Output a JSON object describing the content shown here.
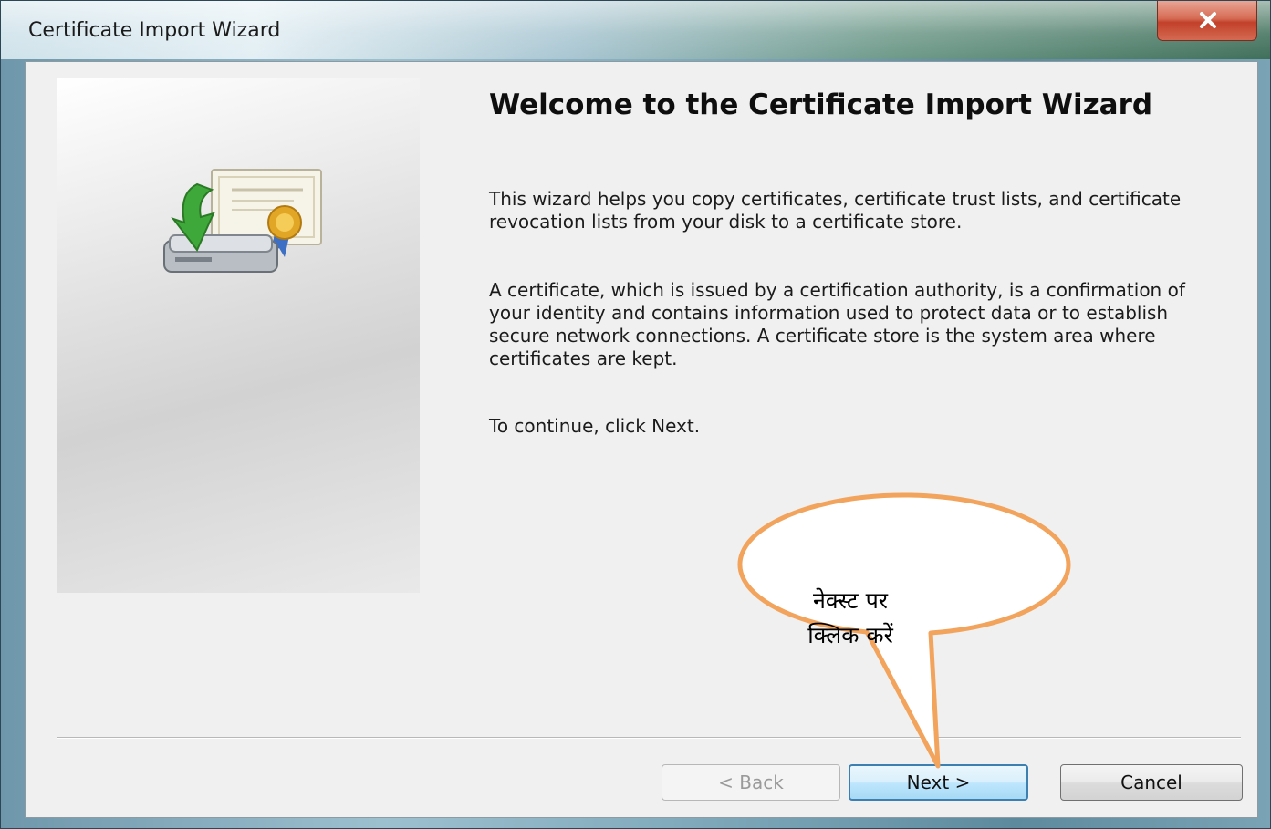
{
  "window": {
    "title": "Certificate Import Wizard",
    "close_icon": "close-icon"
  },
  "content": {
    "heading": "Welcome to the Certificate Import Wizard",
    "paragraph_1": "This wizard helps you copy certificates, certificate trust lists, and certificate revocation lists from your disk to a certificate store.",
    "paragraph_2": "A certificate, which is issued by a certification authority, is a confirmation of your identity and contains information used to protect data or to establish secure network connections. A certificate store is the system area where certificates are kept.",
    "paragraph_3": "To continue, click Next.",
    "illustration_icon": "certificate-import-icon"
  },
  "buttons": {
    "back_label": "< Back",
    "next_label": "Next >",
    "cancel_label": "Cancel"
  },
  "annotation": {
    "callout_line_1": "नेक्स्ट पर",
    "callout_line_2": "क्लिक करें",
    "callout_color": "#f2a35c"
  },
  "colors": {
    "next_button_border": "#3c7fb1",
    "close_button": "#c2402a",
    "callout_fill": "#ffffff"
  }
}
